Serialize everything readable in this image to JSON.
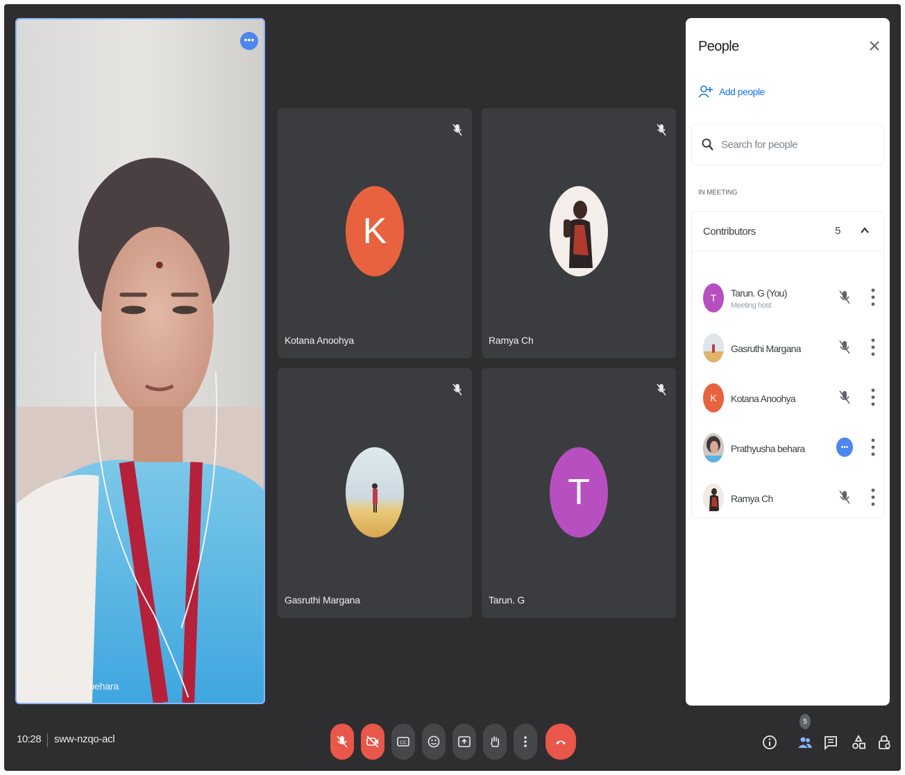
{
  "main_tile": {
    "name": "Prathyusha behara",
    "more_label": "•••"
  },
  "tiles": [
    {
      "name": "Kotana Anoohya",
      "initial": "K",
      "color": "#e8623f"
    },
    {
      "name": "Ramya Ch",
      "initial": "",
      "color": "#f1ece6"
    },
    {
      "name": "Gasruthi Margana",
      "initial": "",
      "color": "#e9e4d7"
    },
    {
      "name": "Tarun. G",
      "initial": "T",
      "color": "#b84fc0"
    }
  ],
  "panel": {
    "title": "People",
    "add_people": "Add people",
    "search_placeholder": "Search for people",
    "section": "IN MEETING",
    "contributors_label": "Contributors",
    "contributors_count": "5",
    "people": [
      {
        "name": "Tarun. G (You)",
        "subtitle": "Meeting host",
        "initial": "T",
        "color": "#b84fc0",
        "status": "muted"
      },
      {
        "name": "Gasruthi Margana",
        "subtitle": "",
        "initial": "",
        "color": "#e6e0d2",
        "status": "muted"
      },
      {
        "name": "Kotana Anoohya",
        "subtitle": "",
        "initial": "K",
        "color": "#e8623f",
        "status": "muted"
      },
      {
        "name": "Prathyusha behara",
        "subtitle": "",
        "initial": "",
        "color": "#6b5a4e",
        "status": "speaking"
      },
      {
        "name": "Ramya Ch",
        "subtitle": "",
        "initial": "",
        "color": "#d8d2cc",
        "status": "muted"
      }
    ]
  },
  "bottom": {
    "time": "10:28",
    "meeting_code": "sww-nzqo-acl",
    "people_badge": "5"
  },
  "colors": {
    "background": "#2e2e30",
    "tile": "#3b3c3f",
    "accent": "#1a73e8",
    "danger": "#e8574a"
  },
  "icons": [
    "mic-off-icon",
    "camera-off-icon",
    "captions-icon",
    "present-icon",
    "raise-hand-icon",
    "more-icon",
    "end-call-icon",
    "info-icon",
    "people-icon",
    "chat-icon",
    "activities-icon",
    "host-controls-icon",
    "pin-icon",
    "search-icon",
    "close-icon",
    "add-person-icon",
    "chevron-up-icon"
  ]
}
